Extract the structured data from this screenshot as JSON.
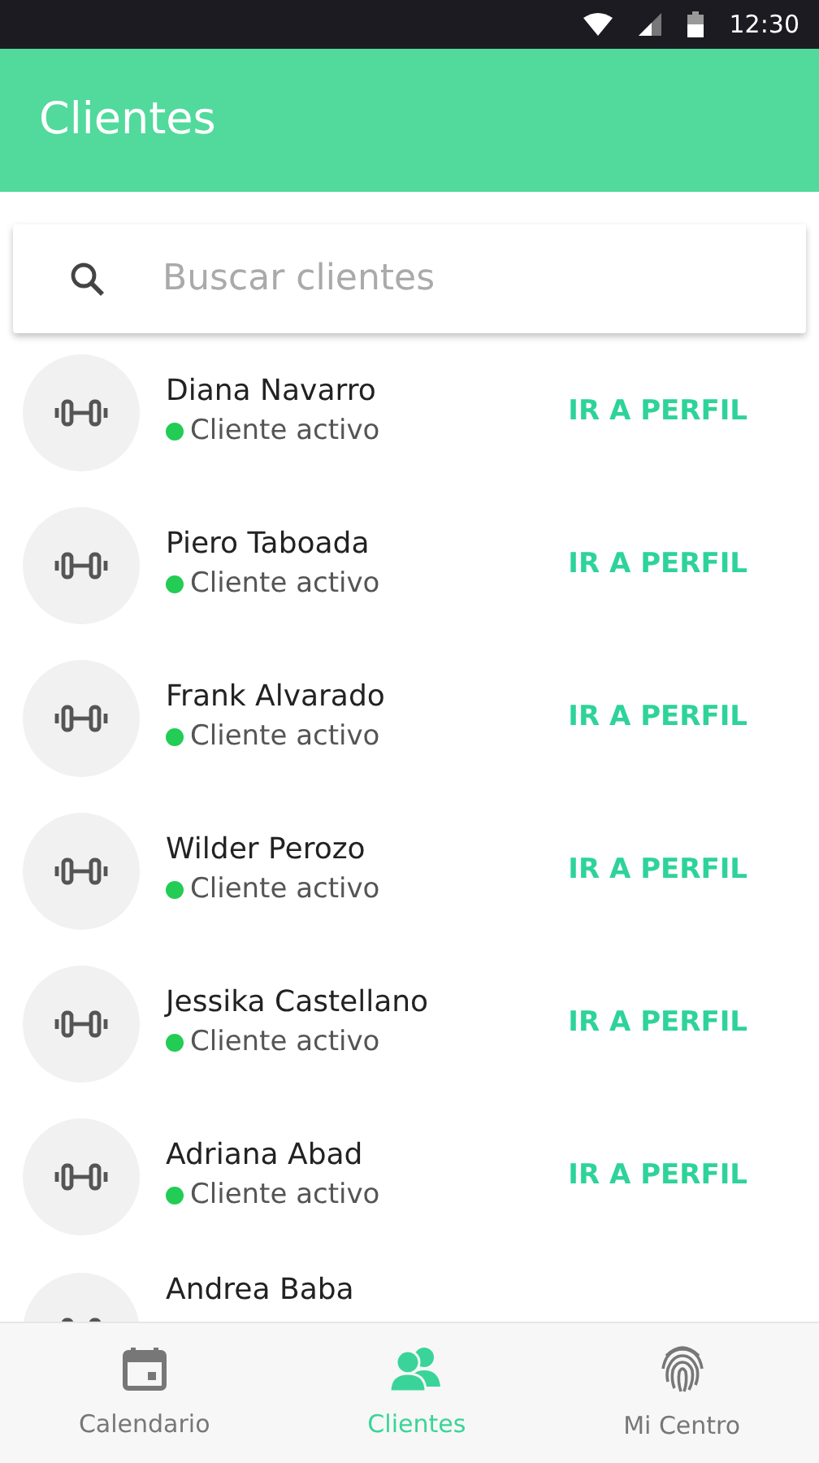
{
  "status_bar": {
    "time": "12:30"
  },
  "app_bar": {
    "title": "Clientes"
  },
  "search": {
    "placeholder": "Buscar clientes"
  },
  "clients": [
    {
      "name": "Diana Navarro",
      "status": "Cliente activo",
      "active": true,
      "action": "IR A PERFIL"
    },
    {
      "name": "Piero Taboada",
      "status": "Cliente activo",
      "active": true,
      "action": "IR A PERFIL"
    },
    {
      "name": "Frank Alvarado",
      "status": "Cliente activo",
      "active": true,
      "action": "IR A PERFIL"
    },
    {
      "name": "Wilder Perozo",
      "status": "Cliente activo",
      "active": true,
      "action": "IR A PERFIL"
    },
    {
      "name": "Jessika Castellano",
      "status": "Cliente activo",
      "active": true,
      "action": "IR A PERFIL"
    },
    {
      "name": "Adriana Abad",
      "status": "Cliente activo",
      "active": true,
      "action": "IR A PERFIL"
    },
    {
      "name": "Andrea Baba"
    }
  ],
  "bottom_nav": [
    {
      "label": "Calendario",
      "kind": "calendar",
      "selected": false
    },
    {
      "label": "Clientes",
      "kind": "clients",
      "selected": true
    },
    {
      "label": "Mi Centro",
      "kind": "fingerprint",
      "selected": false
    }
  ]
}
